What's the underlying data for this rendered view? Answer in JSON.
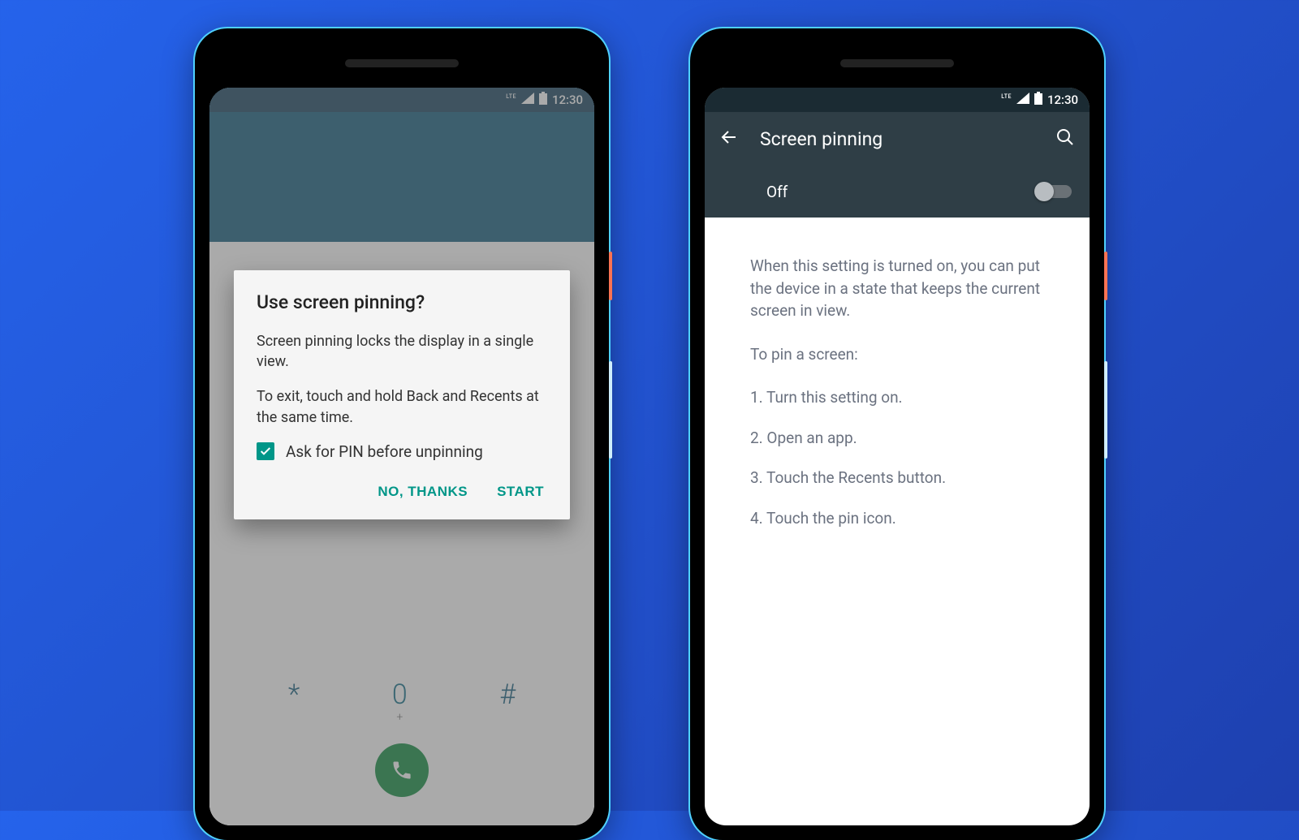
{
  "status": {
    "lte": "LTE",
    "time": "12:30"
  },
  "phone1": {
    "dialog": {
      "title": "Use screen pinning?",
      "paragraph1": "Screen pinning locks the display in a single view.",
      "paragraph2": "To exit, touch and hold Back and Recents at the same time.",
      "checkbox_label": "Ask for PIN before unpinning",
      "checkbox_checked": true,
      "negative": "NO, THANKS",
      "positive": "START"
    },
    "dialpad": {
      "star": "*",
      "zero": "0",
      "plus": "+",
      "hash": "#"
    }
  },
  "phone2": {
    "toolbar_title": "Screen pinning",
    "toggle_state": "Off",
    "description": "When this setting is turned on, you can put the device in a state that keeps the current screen in view.",
    "subheading": "To pin a screen:",
    "steps": [
      "1. Turn this setting on.",
      "2. Open an app.",
      "3. Touch the Recents button.",
      "4. Touch the pin icon."
    ]
  }
}
